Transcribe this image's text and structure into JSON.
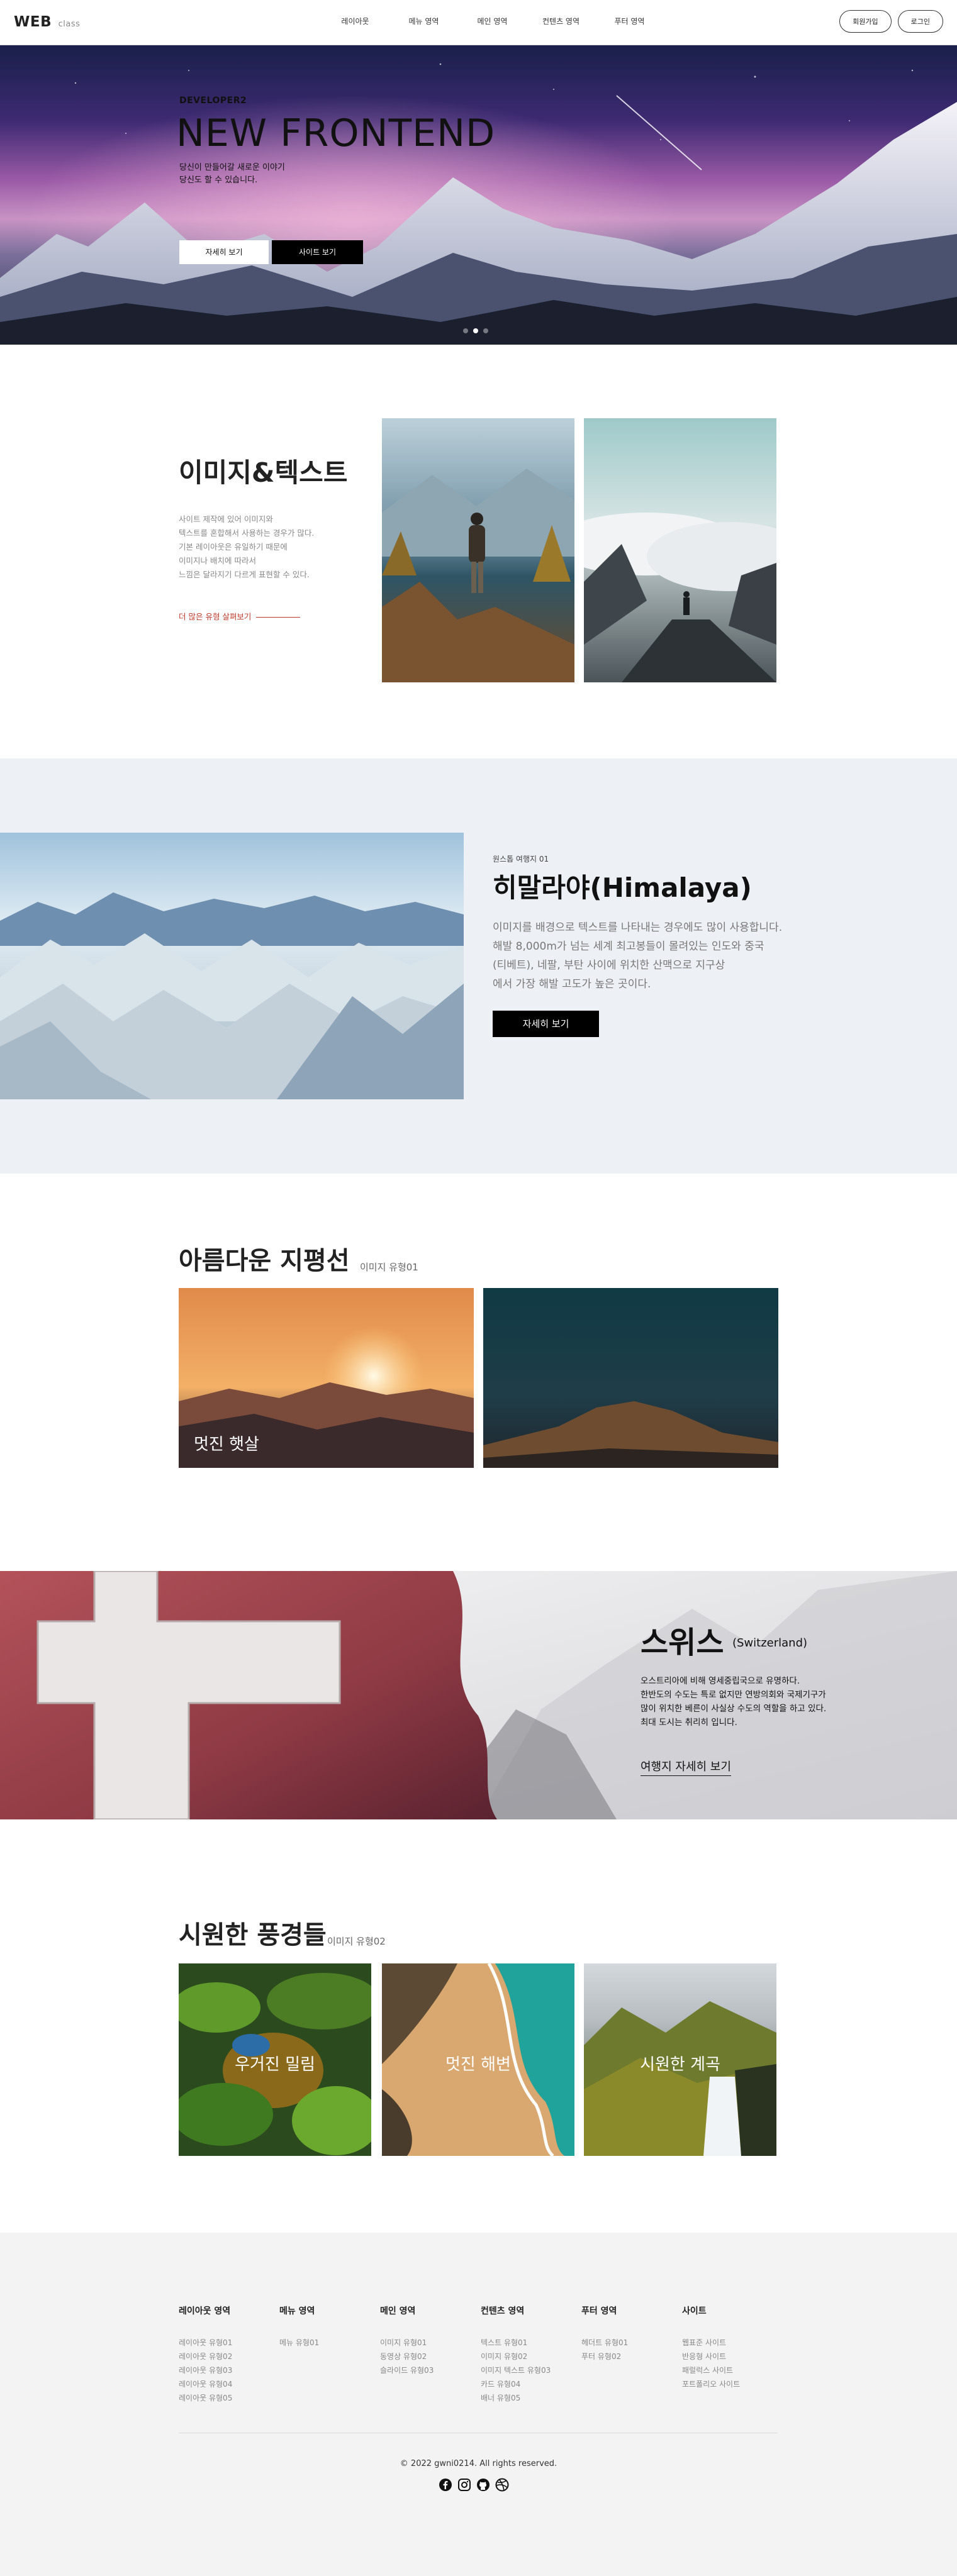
{
  "header": {
    "logo": "WEB",
    "logo_sub": "class",
    "nav": [
      "레이아웃",
      "메뉴 영역",
      "메인 영역",
      "컨텐츠 영역",
      "푸터 영역"
    ],
    "join": "회원가입",
    "login": "로그인"
  },
  "hero": {
    "sub": "DEVELOPER2",
    "title": "NEW FRONTEND",
    "desc": "당신이 만들어갈 새로운 이야기\n당신도 할 수 있습니다.",
    "btn_more": "자세히 보기",
    "btn_site": "사이트 보기",
    "slide_count": 3,
    "active_slide": 2
  },
  "imgtext": {
    "title": "이미지&텍스트",
    "desc": "사이트 제작에 있어 이미지와\n텍스트를 혼합해서 사용하는 경우가 많다.\n기본 레이아웃은 유일하기 때문에\n이미지나 배치에 따라서\n느낌은 달라지기 다르게 표현할 수 있다.",
    "link": "더 많은 유형 살펴보기"
  },
  "himalaya": {
    "tag": "원스톱 여행지 01",
    "title": "히말라야(Himalaya)",
    "desc": "이미지를 배경으로 텍스트를 나타내는 경우에도 많이 사용합니다.\n해발 8,000m가 넘는 세계 최고봉들이 몰려있는 인도와 중국\n(티베트), 네팔, 부탄 사이에 위치한 산맥으로 지구상\n에서 가장 해발 고도가 높은 곳이다.",
    "btn": "자세히 보기"
  },
  "horizon": {
    "title": "아름다운 지평선",
    "sub": "이미지 유형01",
    "card1": "멋진 햇살"
  },
  "swiss": {
    "title": "스위스",
    "title_sub": "(Switzerland)",
    "desc": "오스트리아에 비해 영세중립국으로 유명하다.\n한반도의 수도는 특로 없지만 연방의회와 국제기구가\n많이 위치한 베른이 사실상 수도의 역할을 하고 있다.\n최대 도시는 취리히 입니다.",
    "link": "여행지 자세히 보기"
  },
  "cool": {
    "title": "시원한 풍경들",
    "sub": "이미지 유형02",
    "cards": [
      "우거진 밀림",
      "멋진 해변",
      "시원한 계곡"
    ]
  },
  "footer": {
    "cols": [
      {
        "title": "레이아웃 영역",
        "items": [
          "레이아웃 유형01",
          "레이아웃 유형02",
          "레이아웃 유형03",
          "레이아웃 유형04",
          "레이아웃 유형05"
        ]
      },
      {
        "title": "메뉴 영역",
        "items": [
          "메뉴 유형01"
        ]
      },
      {
        "title": "메인 영역",
        "items": [
          "이미지 유형01",
          "동영상 유형02",
          "슬라이드 유형03"
        ]
      },
      {
        "title": "컨텐츠 영역",
        "items": [
          "텍스트 유형01",
          "이미지 유형02",
          "이미지 텍스트 유형03",
          "카드 유형04",
          "배너 유형05"
        ]
      },
      {
        "title": "푸터 영역",
        "items": [
          "헤더트 유형01",
          "푸터 유형02"
        ]
      },
      {
        "title": "사이트",
        "items": [
          "웹표준 사이트",
          "반응형 사이트",
          "패럴럭스 사이트",
          "포트폴리오 사이트"
        ]
      }
    ],
    "copyright": "© 2022 gwni0214. All rights reserved.",
    "social_icons": [
      "facebook-icon",
      "instagram-icon",
      "github-icon",
      "dribbble-icon"
    ]
  },
  "colors": {
    "accent_red": "#c0392b",
    "black": "#000000",
    "section_bg": "#edf1f5",
    "footer_bg": "#f3f3f3"
  }
}
